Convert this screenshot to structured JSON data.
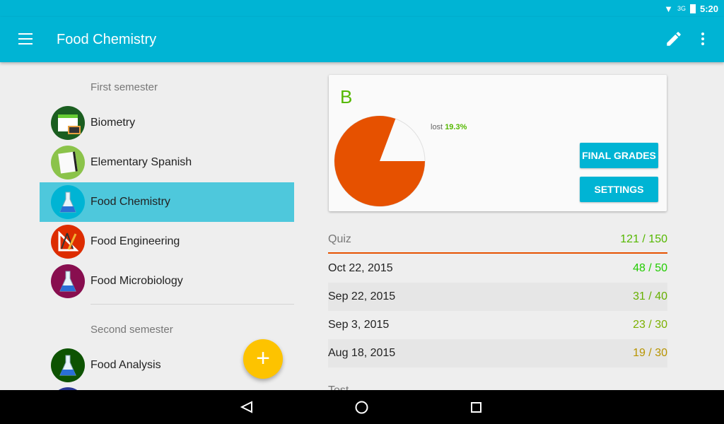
{
  "status": {
    "time": "5:20",
    "network": "3G"
  },
  "appbar": {
    "title": "Food Chemistry"
  },
  "sidebar": {
    "sections": [
      {
        "label": "First semester",
        "items": [
          {
            "label": "Biometry",
            "color": "#1b5e20",
            "icon": "chalkboard-icon"
          },
          {
            "label": "Elementary Spanish",
            "color": "#8bc34a",
            "icon": "notepad-icon"
          },
          {
            "label": "Food Chemistry",
            "color": "#00b4d4",
            "icon": "flask-icon",
            "selected": true
          },
          {
            "label": "Food Engineering",
            "color": "#dd2c00",
            "icon": "drafting-tools-icon"
          },
          {
            "label": "Food Microbiology",
            "color": "#880e4f",
            "icon": "flask-icon"
          }
        ]
      },
      {
        "label": "Second semester",
        "items": [
          {
            "label": "Food Analysis",
            "color": "#0d5302",
            "icon": "flask-icon"
          }
        ]
      }
    ]
  },
  "card": {
    "grade": "B",
    "lost_label": "lost",
    "lost_value": "19.3%",
    "lost_fraction": 0.193,
    "pie_color": "#e65100",
    "final_grades": "FINAL GRADES",
    "settings": "SETTINGS"
  },
  "category": {
    "name": "Quiz",
    "total": "121 / 150",
    "rows": [
      {
        "date": "Oct 22, 2015",
        "score": "48 / 50",
        "color": "#22cc00"
      },
      {
        "date": "Sep 22, 2015",
        "score": "31 / 40",
        "color": "#66b000"
      },
      {
        "date": "Sep 3, 2015",
        "score": "23 / 30",
        "color": "#7cb000"
      },
      {
        "date": "Aug 18, 2015",
        "score": "19 / 30",
        "color": "#b89400"
      }
    ]
  },
  "next_category": {
    "name": "Test"
  },
  "fab": {
    "label": "+"
  }
}
